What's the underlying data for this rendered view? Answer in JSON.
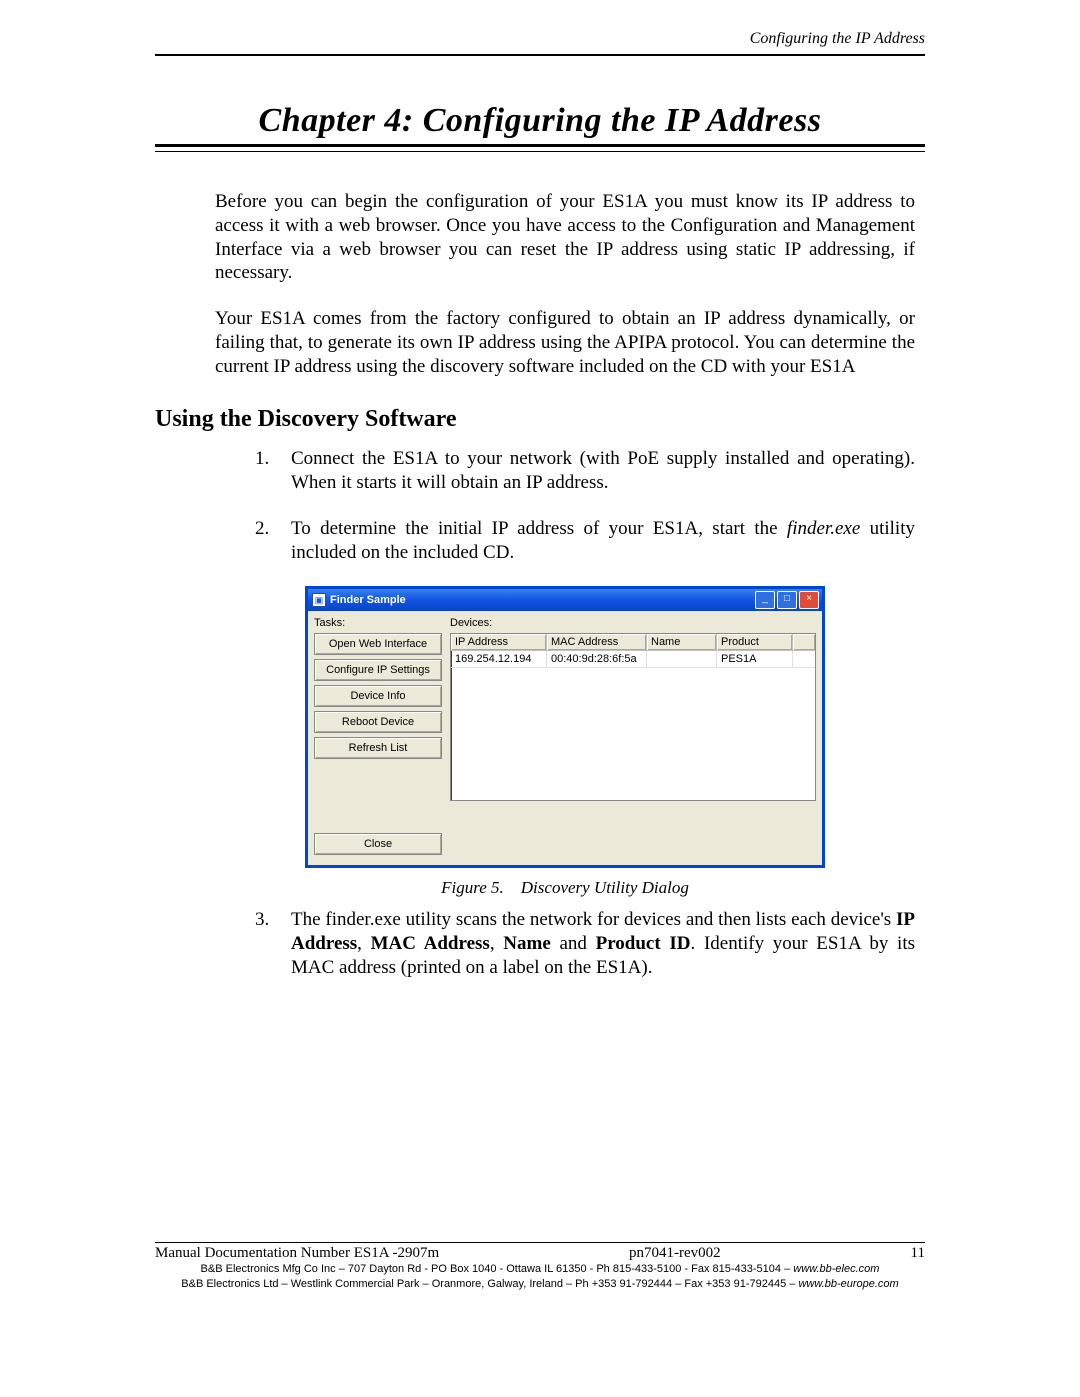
{
  "running_head": "Configuring the IP Address",
  "chapter_title": "Chapter 4:  Configuring the IP Address",
  "para1": "Before you can begin the configuration of your ES1A you must know its IP address to access it with a web browser. Once you have access to the Configuration and Management Interface via a web browser you can reset the IP address using static IP addressing, if necessary.",
  "para2": "Your ES1A comes from the factory configured to obtain an IP address dynamically, or failing that, to generate its own IP address using the APIPA protocol. You can determine the current IP address using the discovery software included on the CD with your ES1A",
  "subhead": "Using the Discovery Software",
  "steps": {
    "s1": "Connect the ES1A to your network (with PoE supply installed and operating). When it starts it will obtain an IP address.",
    "s2a": "To determine the initial IP address of your ES1A, start the ",
    "s2b": "finder.exe",
    "s2c": " utility included on the included CD.",
    "s3a": "The finder.exe utility scans the network for devices and then lists each device's ",
    "s3b": "IP Address",
    "s3c": ", ",
    "s3d": "MAC Address",
    "s3e": ", ",
    "s3f": "Name",
    "s3g": " and ",
    "s3h": "Product ID",
    "s3i": ". Identify your ES1A by its MAC address (printed on a label on the ES1A)."
  },
  "figure": {
    "window_title": "Finder Sample",
    "tasks_label": "Tasks:",
    "devices_label": "Devices:",
    "task_buttons": {
      "b1": "Open Web Interface",
      "b2": "Configure IP Settings",
      "b3": "Device Info",
      "b4": "Reboot Device",
      "b5": "Refresh List",
      "close": "Close"
    },
    "headers": {
      "ip": "IP Address",
      "mac": "MAC Address",
      "name": "Name",
      "product": "Product"
    },
    "row": {
      "ip": "169.254.12.194",
      "mac": "00:40:9d:28:6f:5a",
      "name": "",
      "product": "PES1A"
    },
    "caption_label": "Figure 5.",
    "caption_text": "Discovery Utility Dialog"
  },
  "footer": {
    "left": "Manual Documentation Number ES1A -2907m",
    "mid": "pn7041-rev002",
    "right": "11",
    "line2a": "B&B Electronics Mfg Co Inc – 707 Dayton Rd - PO Box 1040 - Ottawa IL 61350 - Ph 815-433-5100 - Fax 815-433-5104 – ",
    "line2b": "www.bb-elec.com",
    "line3a": "B&B Electronics Ltd – Westlink Commercial Park – Oranmore, Galway, Ireland – Ph +353 91-792444 – Fax +353 91-792445 – ",
    "line3b": "www.bb-europe.com"
  }
}
